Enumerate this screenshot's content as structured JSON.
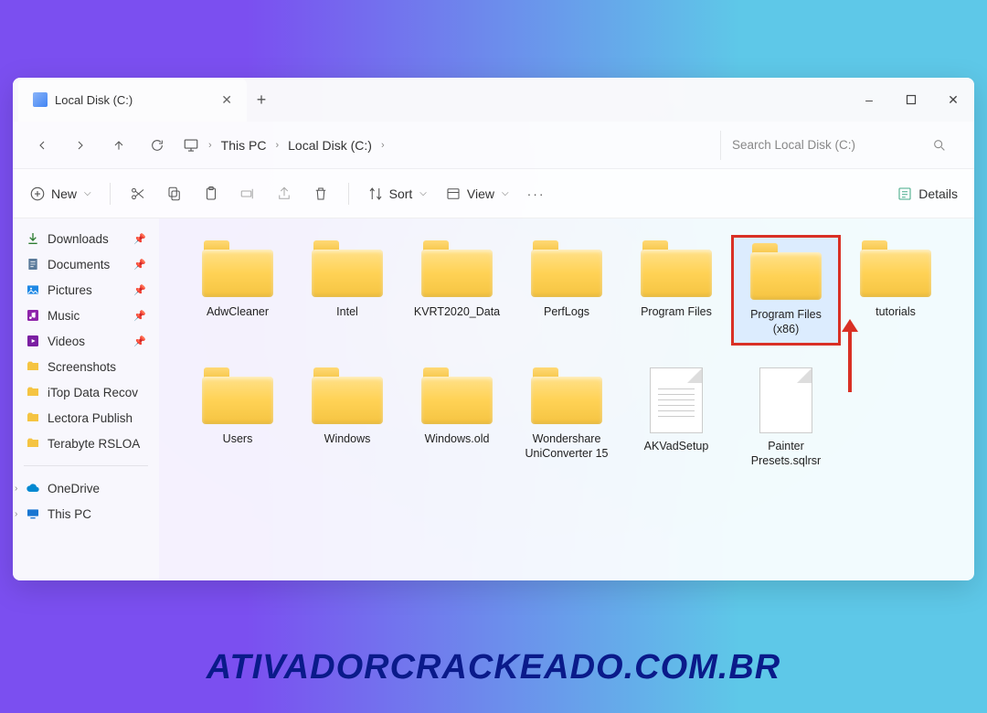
{
  "window": {
    "tab_title": "Local Disk (C:)",
    "minimize": "–",
    "maximize": "▢",
    "close": "✕",
    "newtab": "+",
    "tabclose": "✕"
  },
  "nav": {
    "breadcrumb": [
      "This PC",
      "Local Disk (C:)"
    ],
    "sep": "›"
  },
  "search": {
    "placeholder": "Search Local Disk (C:)"
  },
  "toolbar": {
    "new": "New",
    "sort": "Sort",
    "view": "View",
    "details": "Details",
    "more": "···"
  },
  "sidebar": {
    "pinned": [
      {
        "label": "Downloads",
        "icon": "download",
        "pinned": true
      },
      {
        "label": "Documents",
        "icon": "doc",
        "pinned": true
      },
      {
        "label": "Pictures",
        "icon": "pic",
        "pinned": true
      },
      {
        "label": "Music",
        "icon": "music",
        "pinned": true
      },
      {
        "label": "Videos",
        "icon": "video",
        "pinned": true
      },
      {
        "label": "Screenshots",
        "icon": "folder",
        "pinned": false
      },
      {
        "label": "iTop Data Recov",
        "icon": "folder",
        "pinned": false
      },
      {
        "label": "Lectora Publish",
        "icon": "folder",
        "pinned": false
      },
      {
        "label": "Terabyte RSLOA",
        "icon": "folder",
        "pinned": false
      }
    ],
    "tree": [
      {
        "label": "OneDrive",
        "icon": "cloud",
        "expandable": true
      },
      {
        "label": "This PC",
        "icon": "pc",
        "expandable": true
      }
    ]
  },
  "items": [
    {
      "label": "AdwCleaner",
      "type": "folder"
    },
    {
      "label": "Intel",
      "type": "folder"
    },
    {
      "label": "KVRT2020_Data",
      "type": "folder"
    },
    {
      "label": "PerfLogs",
      "type": "folder"
    },
    {
      "label": "Program Files",
      "type": "folder"
    },
    {
      "label": "Program Files (x86)",
      "type": "folder",
      "highlighted": true,
      "arrow": true
    },
    {
      "label": "tutorials",
      "type": "folder"
    },
    {
      "label": "Users",
      "type": "folder"
    },
    {
      "label": "Windows",
      "type": "folder"
    },
    {
      "label": "Windows.old",
      "type": "folder"
    },
    {
      "label": "Wondershare UniConverter 15",
      "type": "folder"
    },
    {
      "label": "AKVadSetup",
      "type": "file-lines"
    },
    {
      "label": "Painter Presets.sqlrsr",
      "type": "file"
    }
  ],
  "watermark": "ATIVADORCRACKEADO.COM.BR"
}
